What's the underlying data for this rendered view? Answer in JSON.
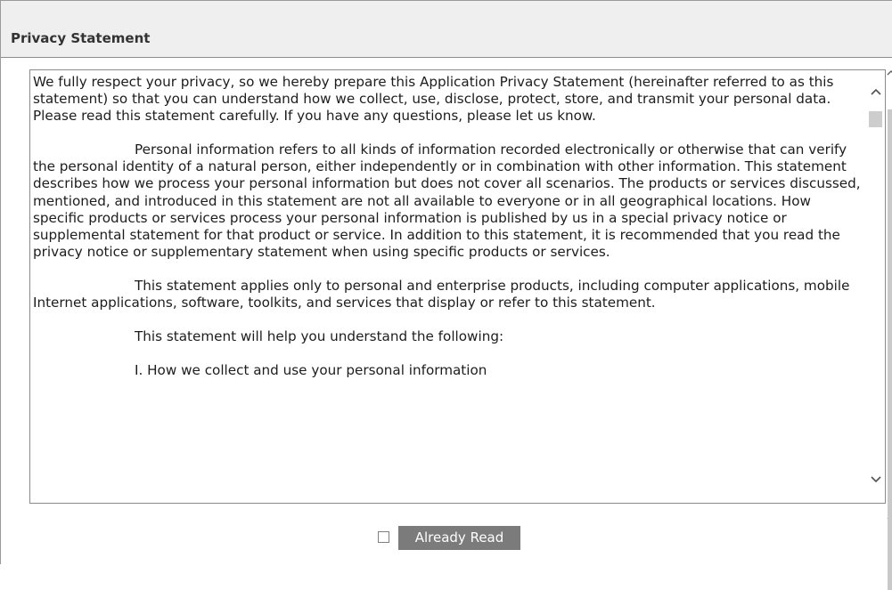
{
  "panel": {
    "title": "Privacy Statement"
  },
  "statement": {
    "paragraphs": [
      "We fully respect your privacy, so we hereby prepare this Application Privacy Statement (hereinafter referred to as this statement) so that you can understand how we collect, use, disclose, protect, store, and transmit your personal data. Please read this statement carefully. If you have any questions, please let us know.",
      "Personal information refers to all kinds of information recorded electronically or otherwise that can verify the personal identity of a natural person, either independently or in combination with other information. This statement describes how we process your personal information but does not cover all scenarios. The products or services discussed, mentioned, and introduced in this statement are not all available to everyone or in all geographical locations. How specific products or services process your personal information is published by us in a special privacy notice or supplemental statement for that product or service. In addition to this statement, it is recommended that you read the privacy notice or supplementary statement when using specific products or services.",
      "This statement applies only to personal and enterprise products, including computer applications, mobile Internet applications, software, toolkits, and services that display or refer to this statement.",
      "This statement will help you understand the following:",
      "I. How we collect and use your personal information"
    ]
  },
  "confirm": {
    "checked": false,
    "button_label": "Already Read"
  },
  "icons": {
    "scroll_up": "chevron-up-icon",
    "scroll_down": "chevron-down-icon",
    "checkbox": "checkbox-icon"
  },
  "colors": {
    "header_bg": "#efefef",
    "button_bg": "#7b7b7b",
    "button_text": "#ffffff",
    "border": "#8a8a8a"
  }
}
